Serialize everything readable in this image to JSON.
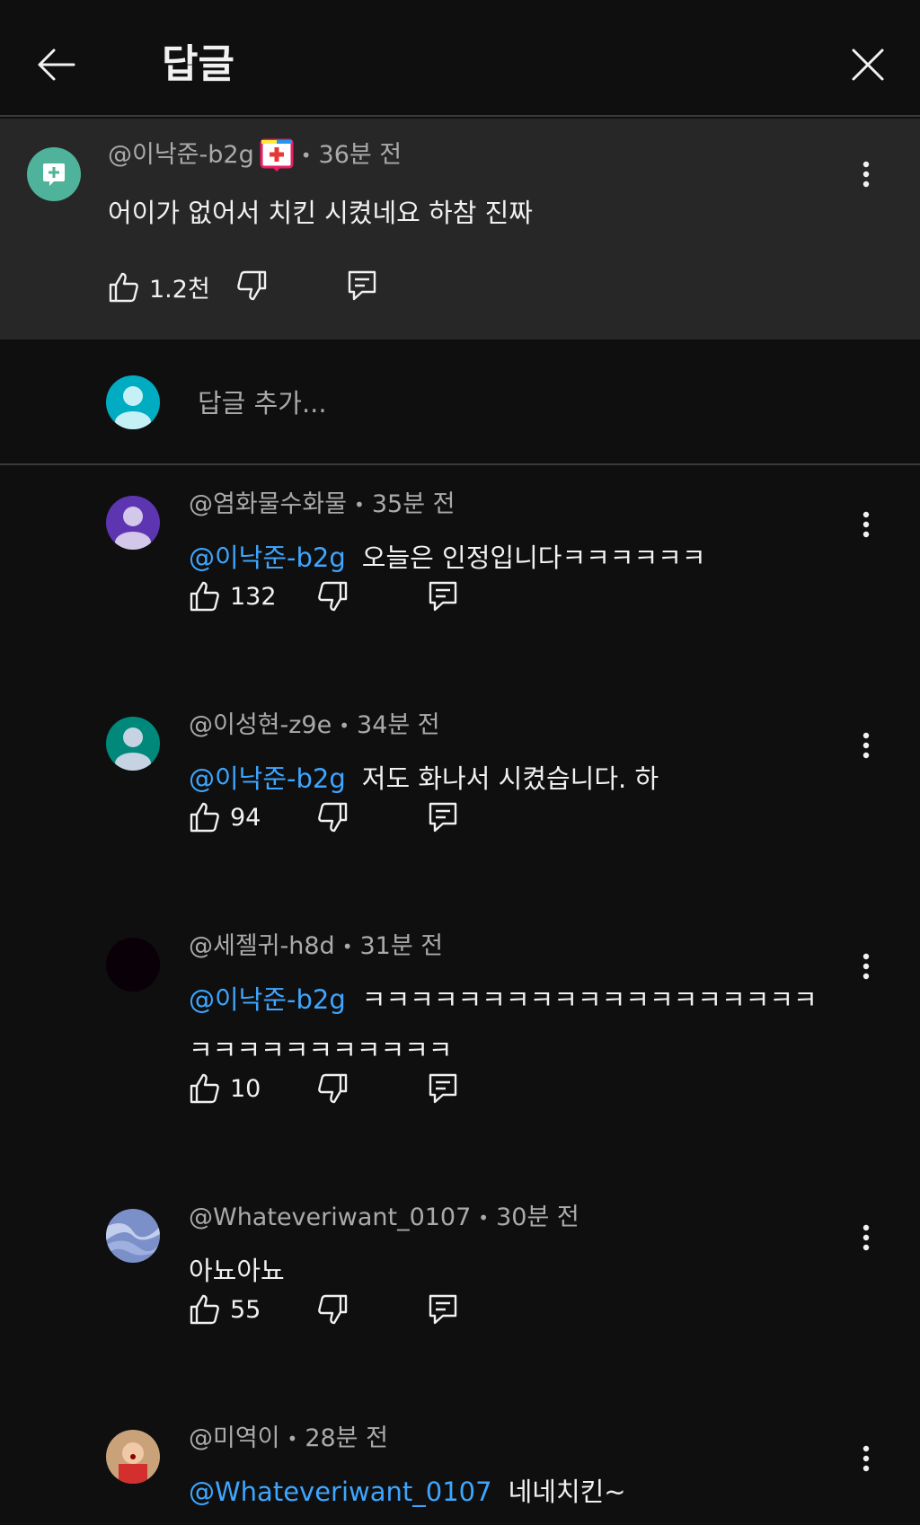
{
  "header": {
    "title": "답글"
  },
  "parent_comment": {
    "author": "@이낙준-b2g",
    "time": "36분 전",
    "text": "어이가 없어서 치킨 시켰네요 하참 진짜",
    "likes": "1.2천",
    "avatar_color": "#4fb29a"
  },
  "add_reply": {
    "placeholder": "답글 추가..."
  },
  "replies": [
    {
      "author": "@염화물수화물",
      "time": "35분 전",
      "mention": "@이낙준-b2g",
      "text": "오늘은 인정입니다ㅋㅋㅋㅋㅋㅋ",
      "text2": "",
      "likes": "132",
      "avatar_color": "#5e35b1"
    },
    {
      "author": "@이성현-z9e",
      "time": "34분 전",
      "mention": "@이낙준-b2g",
      "text": "저도 화나서 시켰습니다. 하",
      "text2": "",
      "likes": "94",
      "avatar_color": "#00897b"
    },
    {
      "author": "@세젤귀-h8d",
      "time": "31분 전",
      "mention": "@이낙준-b2g",
      "text": "ㅋㅋㅋㅋㅋㅋㅋㅋㅋㅋㅋㅋㅋㅋㅋㅋㅋㅋㅋ",
      "text2": "ㅋㅋㅋㅋㅋㅋㅋㅋㅋㅋㅋ",
      "likes": "10",
      "avatar_color": "#0a0008"
    },
    {
      "author": "@Whateveriwant_0107",
      "time": "30분 전",
      "mention": "",
      "text": "아뇨아뇨",
      "text2": "",
      "likes": "55",
      "avatar_color": "#7b8fc9"
    },
    {
      "author": "@미역이",
      "time": "28분 전",
      "mention": "@Whateveriwant_0107",
      "text": "네네치킨~",
      "text2": "",
      "likes": "",
      "avatar_color": "#c9a27a"
    }
  ],
  "colors": {
    "background": "#0f0f0f",
    "parent_bg": "#272727",
    "mention": "#3ea6ff",
    "meta": "#aaaaaa"
  },
  "icons": [
    "back-arrow-icon",
    "close-icon",
    "kebab-menu-icon",
    "thumbs-up-icon",
    "thumbs-down-icon",
    "reply-icon",
    "person-icon",
    "add-comment-icon",
    "badge-icon"
  ]
}
